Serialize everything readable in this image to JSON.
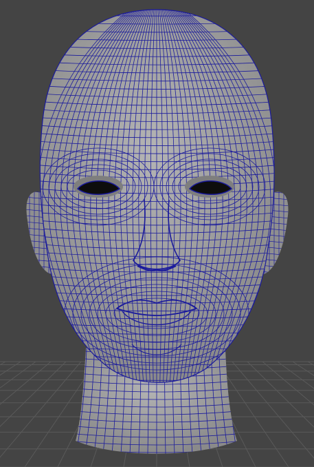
{
  "viewport": {
    "background_color": "#444444",
    "grid_color": "#5a5a5a",
    "wire_color": "#1a1a9c",
    "skin_color": "#9a9a9a",
    "skin_highlight_color": "#b4b4b4",
    "eye_color": "#0d0d0d"
  },
  "scene": {
    "object": "head-mesh",
    "display_mode": "wireframe-on-shaded",
    "ground_grid": true
  }
}
